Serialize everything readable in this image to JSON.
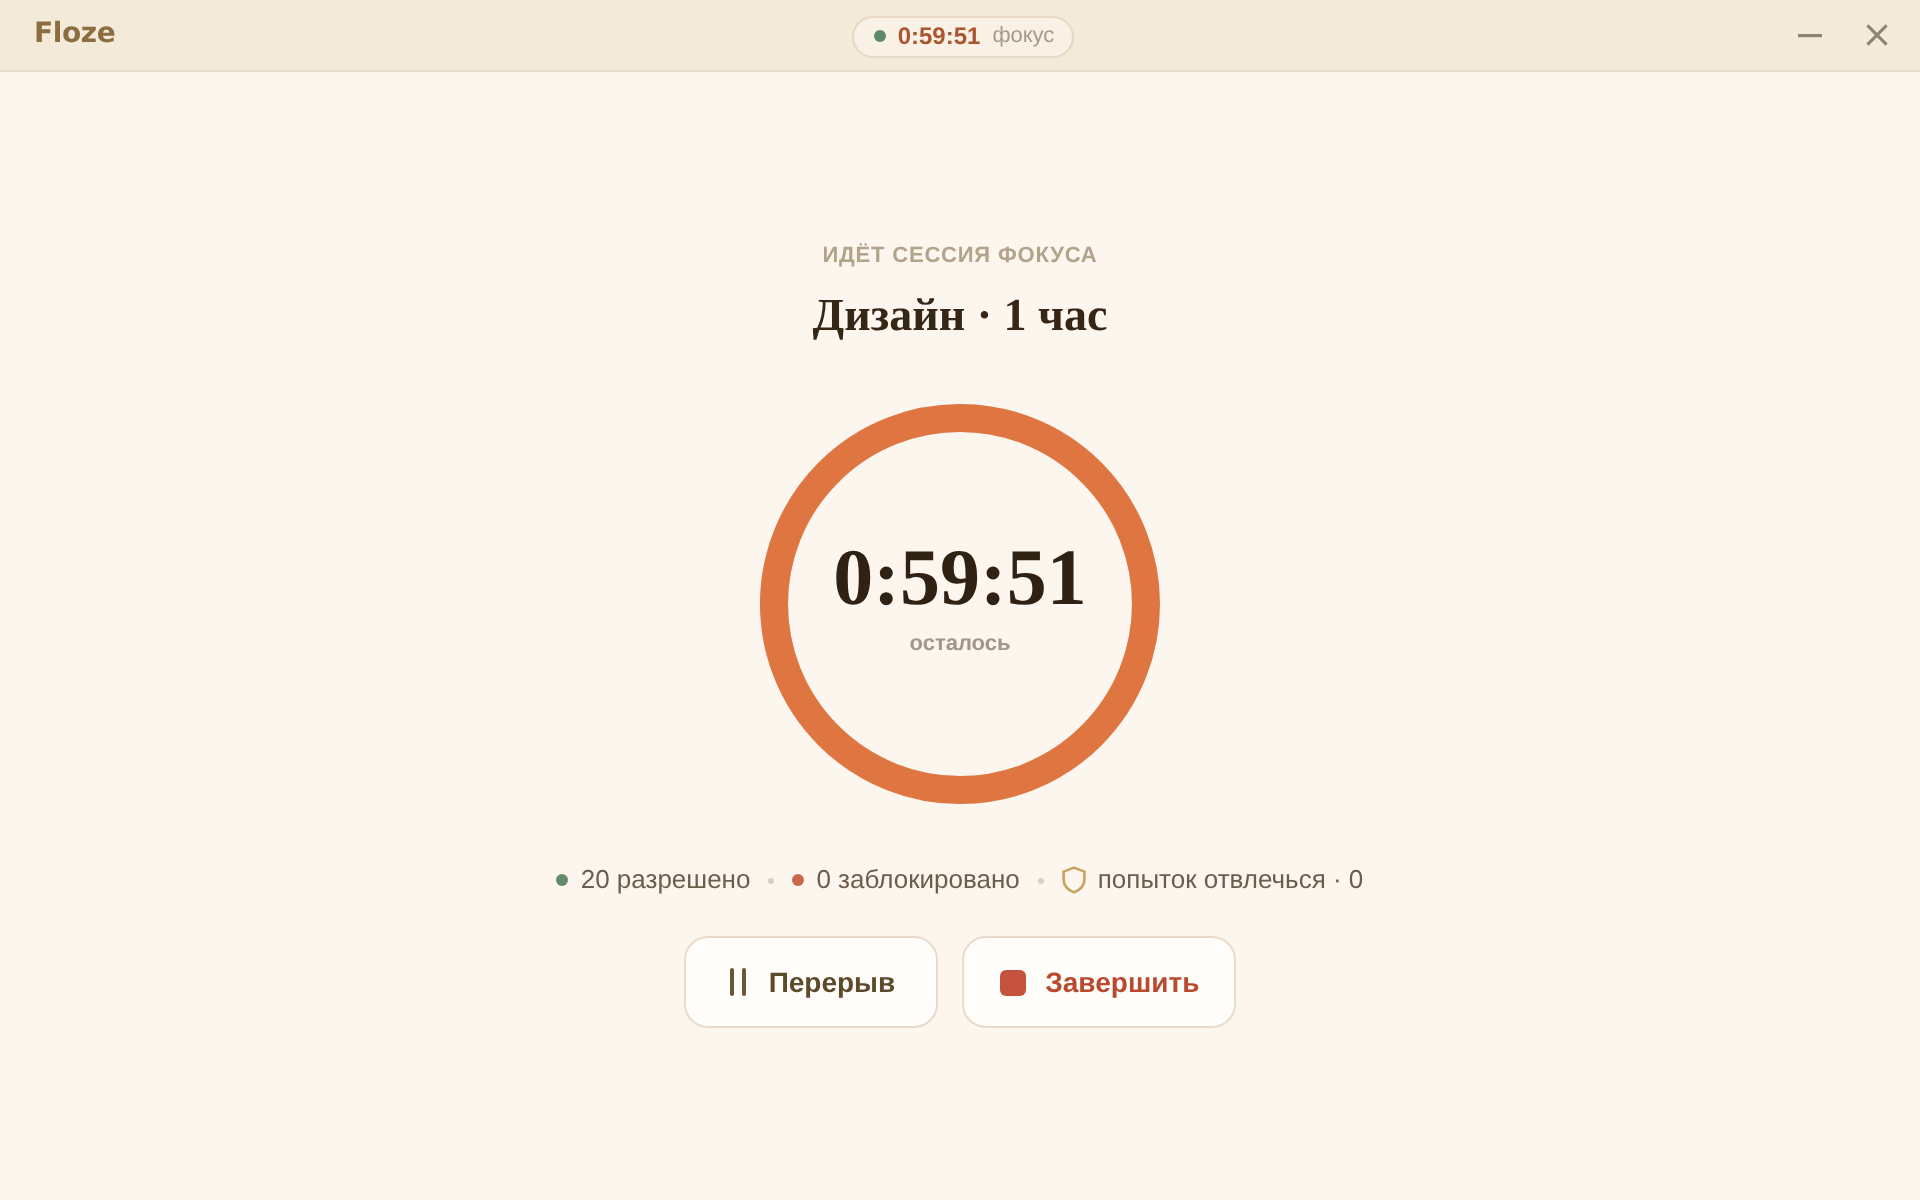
{
  "window": {
    "app_name": "Floze",
    "timer_pill": {
      "time": "0:59:51",
      "label": "фокус"
    }
  },
  "session": {
    "status_label": "ИДЁТ СЕССИЯ ФОКУСА",
    "title": "Дизайн · 1 час",
    "timer": {
      "time": "0:59:51",
      "caption": "осталось",
      "level": 1
    }
  },
  "stats": [
    {
      "kind": "dot",
      "color": "#628c6c",
      "text": "20 разрешено"
    },
    {
      "kind": "dot",
      "color": "#c9674a",
      "text": "0 заблокировано"
    },
    {
      "kind": "shield",
      "text": "попыток отвлечься · 0"
    }
  ],
  "buttons": [
    {
      "kind": "pause",
      "label": "Перерыв"
    },
    {
      "kind": "stop",
      "label": "Завершить"
    }
  ]
}
